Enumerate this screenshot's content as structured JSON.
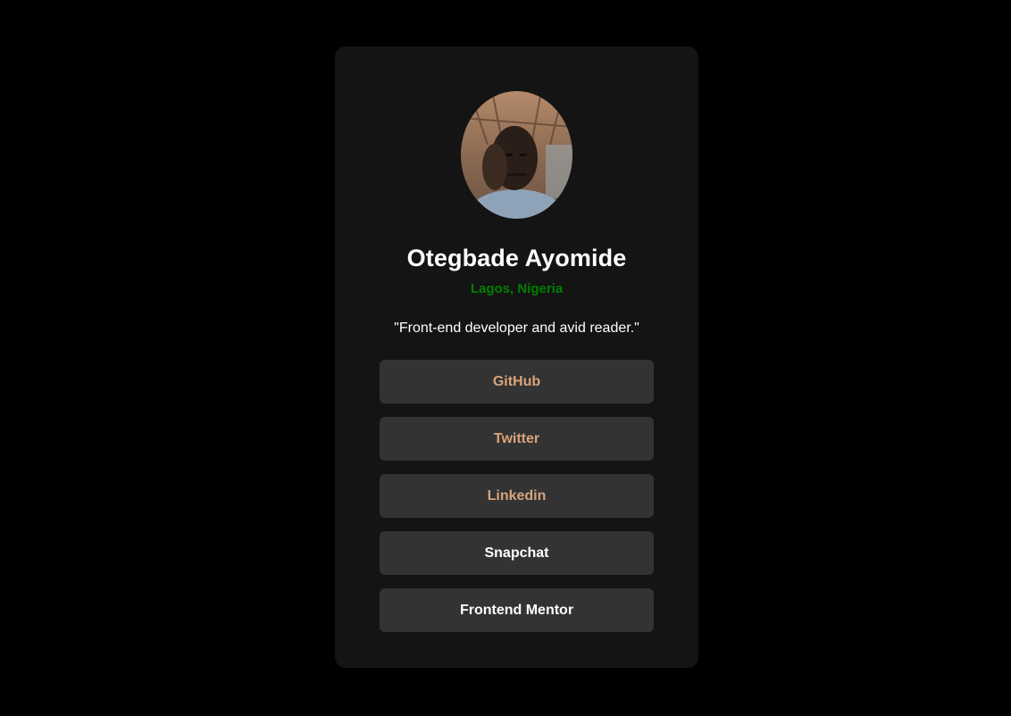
{
  "profile": {
    "name": "Otegbade Ayomide",
    "location": "Lagos, Nigeria",
    "bio": "\"Front-end developer and avid reader.\""
  },
  "links": [
    {
      "label": "GitHub",
      "color": "#d8a37a"
    },
    {
      "label": "Twitter",
      "color": "#d8a37a"
    },
    {
      "label": "Linkedin",
      "color": "#d8a37a"
    },
    {
      "label": "Snapchat",
      "color": "#ffffff"
    },
    {
      "label": "Frontend Mentor",
      "color": "#ffffff"
    }
  ],
  "colors": {
    "background": "#000000",
    "card": "#141414",
    "button": "#333333",
    "accent_location": "#008000"
  }
}
